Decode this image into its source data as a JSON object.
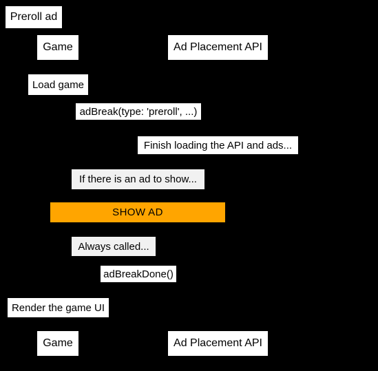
{
  "diagram": {
    "kind": "sequence-diagram",
    "title": "Preroll ad",
    "background_color": "#000000",
    "box_fill_color": "#ffffff",
    "note_fill_color": "#f1f1f1",
    "highlight_color": "#ffa500",
    "text_color": "#000000",
    "participants": [
      {
        "id": "game",
        "label": "Game"
      },
      {
        "id": "api",
        "label": "Ad Placement API"
      }
    ],
    "participants_bottom": [
      {
        "id": "game",
        "label": "Game"
      },
      {
        "id": "api",
        "label": "Ad Placement API"
      }
    ],
    "steps": [
      {
        "id": "load-game",
        "label": "Load game",
        "style": "message"
      },
      {
        "id": "adbreak-call",
        "label": "adBreak(type: 'preroll', ...)",
        "style": "message"
      },
      {
        "id": "finish-loading",
        "label": "Finish loading the API and ads...",
        "style": "message"
      },
      {
        "id": "if-ad-to-show",
        "label": "If there is an ad to show...",
        "style": "note"
      },
      {
        "id": "show-ad",
        "label": "SHOW AD",
        "style": "highlight"
      },
      {
        "id": "always-called",
        "label": "Always called...",
        "style": "note"
      },
      {
        "id": "adbreakdone-call",
        "label": "adBreakDone()",
        "style": "message"
      },
      {
        "id": "render-game-ui",
        "label": "Render the game UI",
        "style": "message"
      }
    ]
  }
}
